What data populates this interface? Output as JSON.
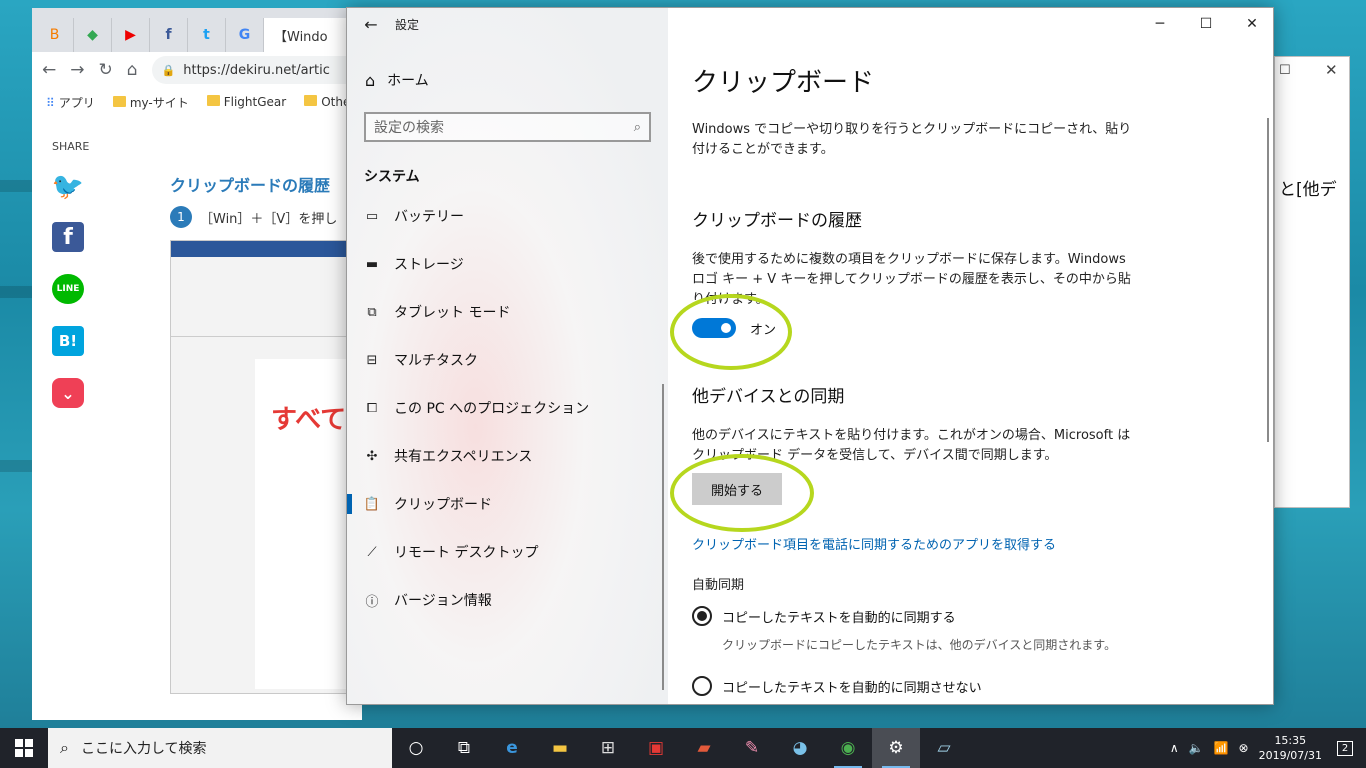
{
  "browser": {
    "tabs": [
      {
        "icon": "blogger-icon",
        "glyph": "B"
      },
      {
        "icon": "maps-icon",
        "glyph": "◆"
      },
      {
        "icon": "youtube-icon",
        "glyph": "▶"
      },
      {
        "icon": "facebook-icon",
        "glyph": "f"
      },
      {
        "icon": "twitter-icon",
        "glyph": "t"
      },
      {
        "icon": "google-icon",
        "glyph": "G"
      }
    ],
    "active_tab": "【Windo",
    "url": "https://dekiru.net/artic",
    "bookmarks": {
      "apps": "アプリ",
      "b1": "my-サイト",
      "b2": "FlightGear",
      "b3": "Othe"
    },
    "share_label": "SHARE",
    "article_heading": "クリップボードの履歴",
    "step_number": "1",
    "step_text": "［Win］＋［V］を押し",
    "screenshot_text": "すべて"
  },
  "bg_window": {
    "text": "と[他デ"
  },
  "settings": {
    "title": "設定",
    "home": "ホーム",
    "search_placeholder": "設定の検索",
    "group": "システム",
    "nav": [
      {
        "label": "バッテリー"
      },
      {
        "label": "ストレージ"
      },
      {
        "label": "タブレット モード"
      },
      {
        "label": "マルチタスク"
      },
      {
        "label": "この PC へのプロジェクション"
      },
      {
        "label": "共有エクスペリエンス"
      },
      {
        "label": "クリップボード"
      },
      {
        "label": "リモート デスクトップ"
      },
      {
        "label": "バージョン情報"
      }
    ],
    "page_title": "クリップボード",
    "intro": "Windows でコピーや切り取りを行うとクリップボードにコピーされ、貼り付けることができます。",
    "history_heading": "クリップボードの履歴",
    "history_desc": "後で使用するために複数の項目をクリップボードに保存します。Windows ロゴ キー + V キーを押してクリップボードの履歴を表示し、その中から貼り付けます。",
    "toggle_state": "オン",
    "sync_heading": "他デバイスとの同期",
    "sync_desc": "他のデバイスにテキストを貼り付けます。これがオンの場合、Microsoft はクリップボード データを受信して、デバイス間で同期します。",
    "start_button": "開始する",
    "app_link": "クリップボード項目を電話に同期するためのアプリを取得する",
    "auto_sync_label": "自動同期",
    "radio1": "コピーしたテキストを自動的に同期する",
    "radio1_sub": "クリップボードにコピーしたテキストは、他のデバイスと同期されます。",
    "radio2": "コピーしたテキストを自動的に同期させない"
  },
  "taskbar": {
    "search_placeholder": "ここに入力して検索",
    "time": "15:35",
    "date": "2019/07/31",
    "notifications": "2"
  },
  "colors": {
    "accent": "#0078d7",
    "link": "#0063b1",
    "highlight_ring": "#b6d71e",
    "taskbar": "#20232a"
  }
}
